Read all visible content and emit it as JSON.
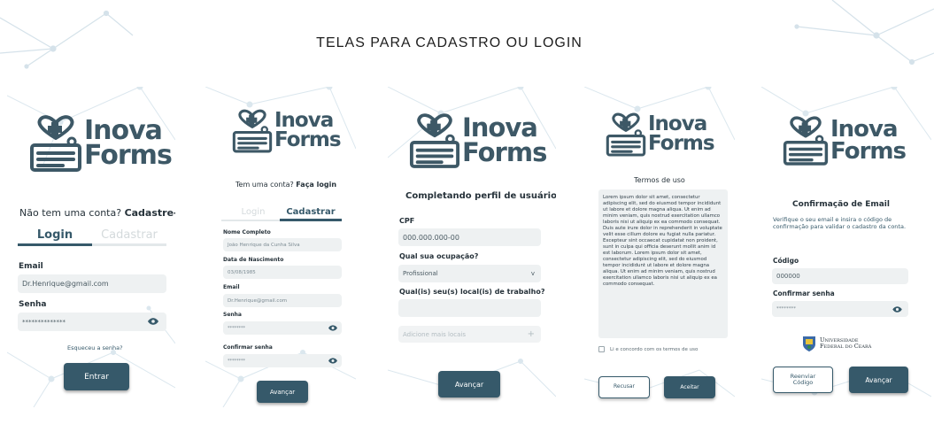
{
  "page": {
    "title": "TELAS PARA CADASTRO OU LOGIN"
  },
  "brand": {
    "line1": "Inova",
    "line2": "Forms",
    "color": "#3d5866",
    "accent": "#36596a"
  },
  "screen1": {
    "prompt_text": "Não tem uma conta?",
    "prompt_link": "Cadastre-se",
    "tab_login": "Login",
    "tab_register": "Cadastrar",
    "email_label": "Email",
    "email_value": "Dr.Henrique@gmail.com",
    "password_label": "Senha",
    "password_value": "**************",
    "forgot": "Esqueceu a senha?",
    "submit": "Entrar"
  },
  "screen2": {
    "prompt_text": "Tem uma conta?",
    "prompt_link": "Faça login",
    "tab_login": "Login",
    "tab_register": "Cadastrar",
    "name_label": "Nome Completo",
    "name_value": "João Henrique da Cunha Silva",
    "birth_label": "Data de Nascimento",
    "birth_value": "03/08/1985",
    "email_label": "Email",
    "email_value": "Dr.Henrique@gmail.com",
    "password_label": "Senha",
    "password_value": "********",
    "confirm_label": "Confirmar senha",
    "confirm_value": "********",
    "submit": "Avançar"
  },
  "screen3": {
    "heading": "Completando perfil de usuário",
    "cpf_label": "CPF",
    "cpf_value": "000.000.000-00",
    "occupation_label": "Qual sua ocupação?",
    "occupation_value": "Profissional",
    "occupation_arrow": "v",
    "workplace_label": "Qual(is) seu(s) local(is) de trabalho?",
    "workplace_value": "",
    "add_placeholder": "Adicione mais locais",
    "add_symbol": "+",
    "submit": "Avançar"
  },
  "screen4": {
    "heading": "Termos de uso",
    "terms_text": "Lorem ipsum dolor sit amet, consectetur adipiscing elit, sed do eiusmod tempor incididunt ut labore et dolore magna aliqua. Ut enim ad minim veniam, quis nostrud exercitation ullamco laboris nisi ut aliquip ex ea commodo consequat. Duis aute irure dolor in reprehenderit in voluptate velit esse cillum dolore eu fugiat nulla pariatur. Excepteur sint occaecat cupidatat non proident, sunt in culpa qui officia deserunt mollit anim id est laborum.  Lorem ipsum dolor sit amet, consectetur adipiscing elit, sed do eiusmod tempor incididunt ut labore et dolore magna aliqua. Ut enim ad minim veniam, quis nostrud exercitation ullamco laboris nisi ut aliquip ex ea commodo consequat.",
    "agree_label": "Li e concordo com os termos de uso",
    "reject": "Recusar",
    "accept": "Aceitar"
  },
  "screen5": {
    "heading": "Confirmação de Email",
    "instructions": "Verifique o seu email e insira o código de confirmação para validar o cadastro da conta.",
    "code_label": "Código",
    "code_value": "000000",
    "confirm_label": "Confirmar senha",
    "confirm_value": "********",
    "university_line1": "Universidade",
    "university_line2": "Federal do Ceará",
    "resend_line1": "Reenviar",
    "resend_line2": "Código",
    "submit": "Avançar"
  }
}
